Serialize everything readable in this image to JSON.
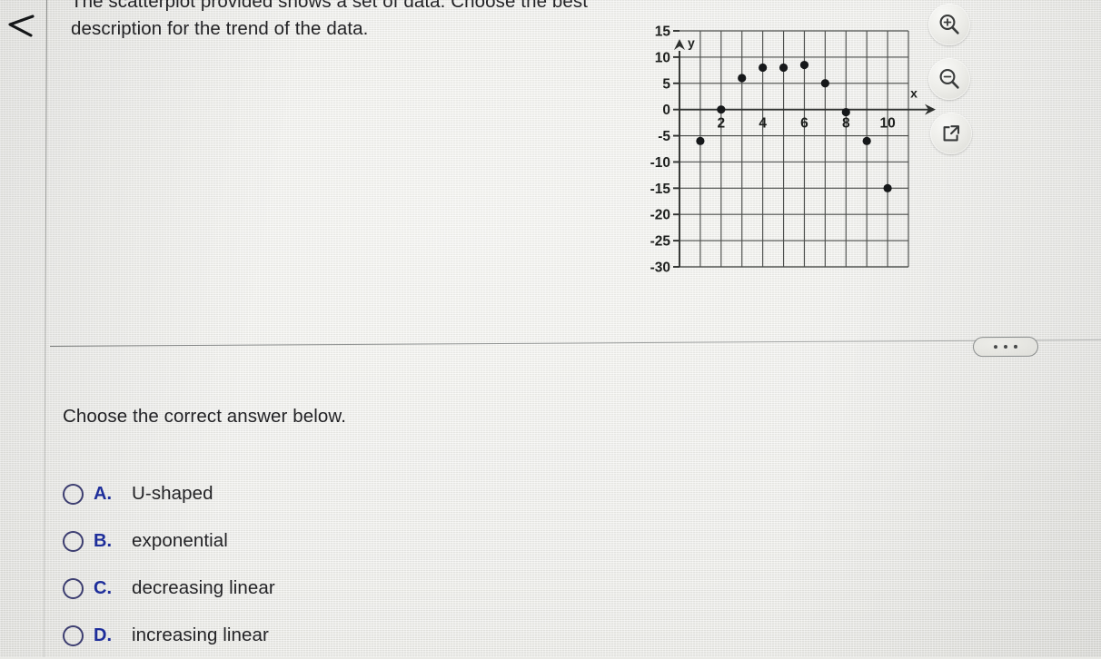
{
  "app": {
    "background_color": "#e9e9e5",
    "text_color": "#232326",
    "accent_color": "#1f2f9e"
  },
  "nav": {
    "back_icon": "back-arrow-icon"
  },
  "question": {
    "text": "The scatterplot provided shows a set of data. Choose the best description for the trend of the data.",
    "truncated_top": true
  },
  "toolbar": {
    "buttons": [
      {
        "name": "zoom-in-button",
        "icon": "magnifier-plus-icon"
      },
      {
        "name": "zoom-out-button",
        "icon": "magnifier-minus-icon"
      },
      {
        "name": "open-in-new-window-button",
        "icon": "external-link-icon"
      }
    ],
    "more_label": "…"
  },
  "answer": {
    "prompt": "Choose the correct answer below.",
    "choices": [
      {
        "letter": "A.",
        "text": "U-shaped",
        "selected": false
      },
      {
        "letter": "B.",
        "text": "exponential",
        "selected": false
      },
      {
        "letter": "C.",
        "text": "decreasing linear",
        "selected": false
      },
      {
        "letter": "D.",
        "text": "increasing linear",
        "selected": false
      }
    ]
  },
  "chart_data": {
    "type": "scatter",
    "title": "",
    "xlabel": "x",
    "ylabel": "y",
    "xlim": [
      0,
      11
    ],
    "ylim": [
      -30,
      15
    ],
    "xticks": [
      2,
      4,
      6,
      8,
      10
    ],
    "yticks": [
      15,
      10,
      5,
      0,
      -5,
      -10,
      -15,
      -20,
      -25,
      -30
    ],
    "xtick_labels": [
      "2",
      "4",
      "6",
      "8",
      "10"
    ],
    "ytick_labels": [
      "15",
      "10",
      "5",
      "0",
      "-5",
      "-10",
      "-15",
      "-20",
      "-25",
      "-30"
    ],
    "grid": true,
    "grid_step_x": 1,
    "grid_step_y": 5,
    "legend": "none",
    "points": [
      {
        "x": 1,
        "y": -6
      },
      {
        "x": 2,
        "y": 0
      },
      {
        "x": 3,
        "y": 6
      },
      {
        "x": 4,
        "y": 8
      },
      {
        "x": 5,
        "y": 8
      },
      {
        "x": 6,
        "y": 8.5
      },
      {
        "x": 7,
        "y": 5
      },
      {
        "x": 8,
        "y": -0.5
      },
      {
        "x": 9,
        "y": -6
      },
      {
        "x": 10,
        "y": -15
      }
    ]
  }
}
